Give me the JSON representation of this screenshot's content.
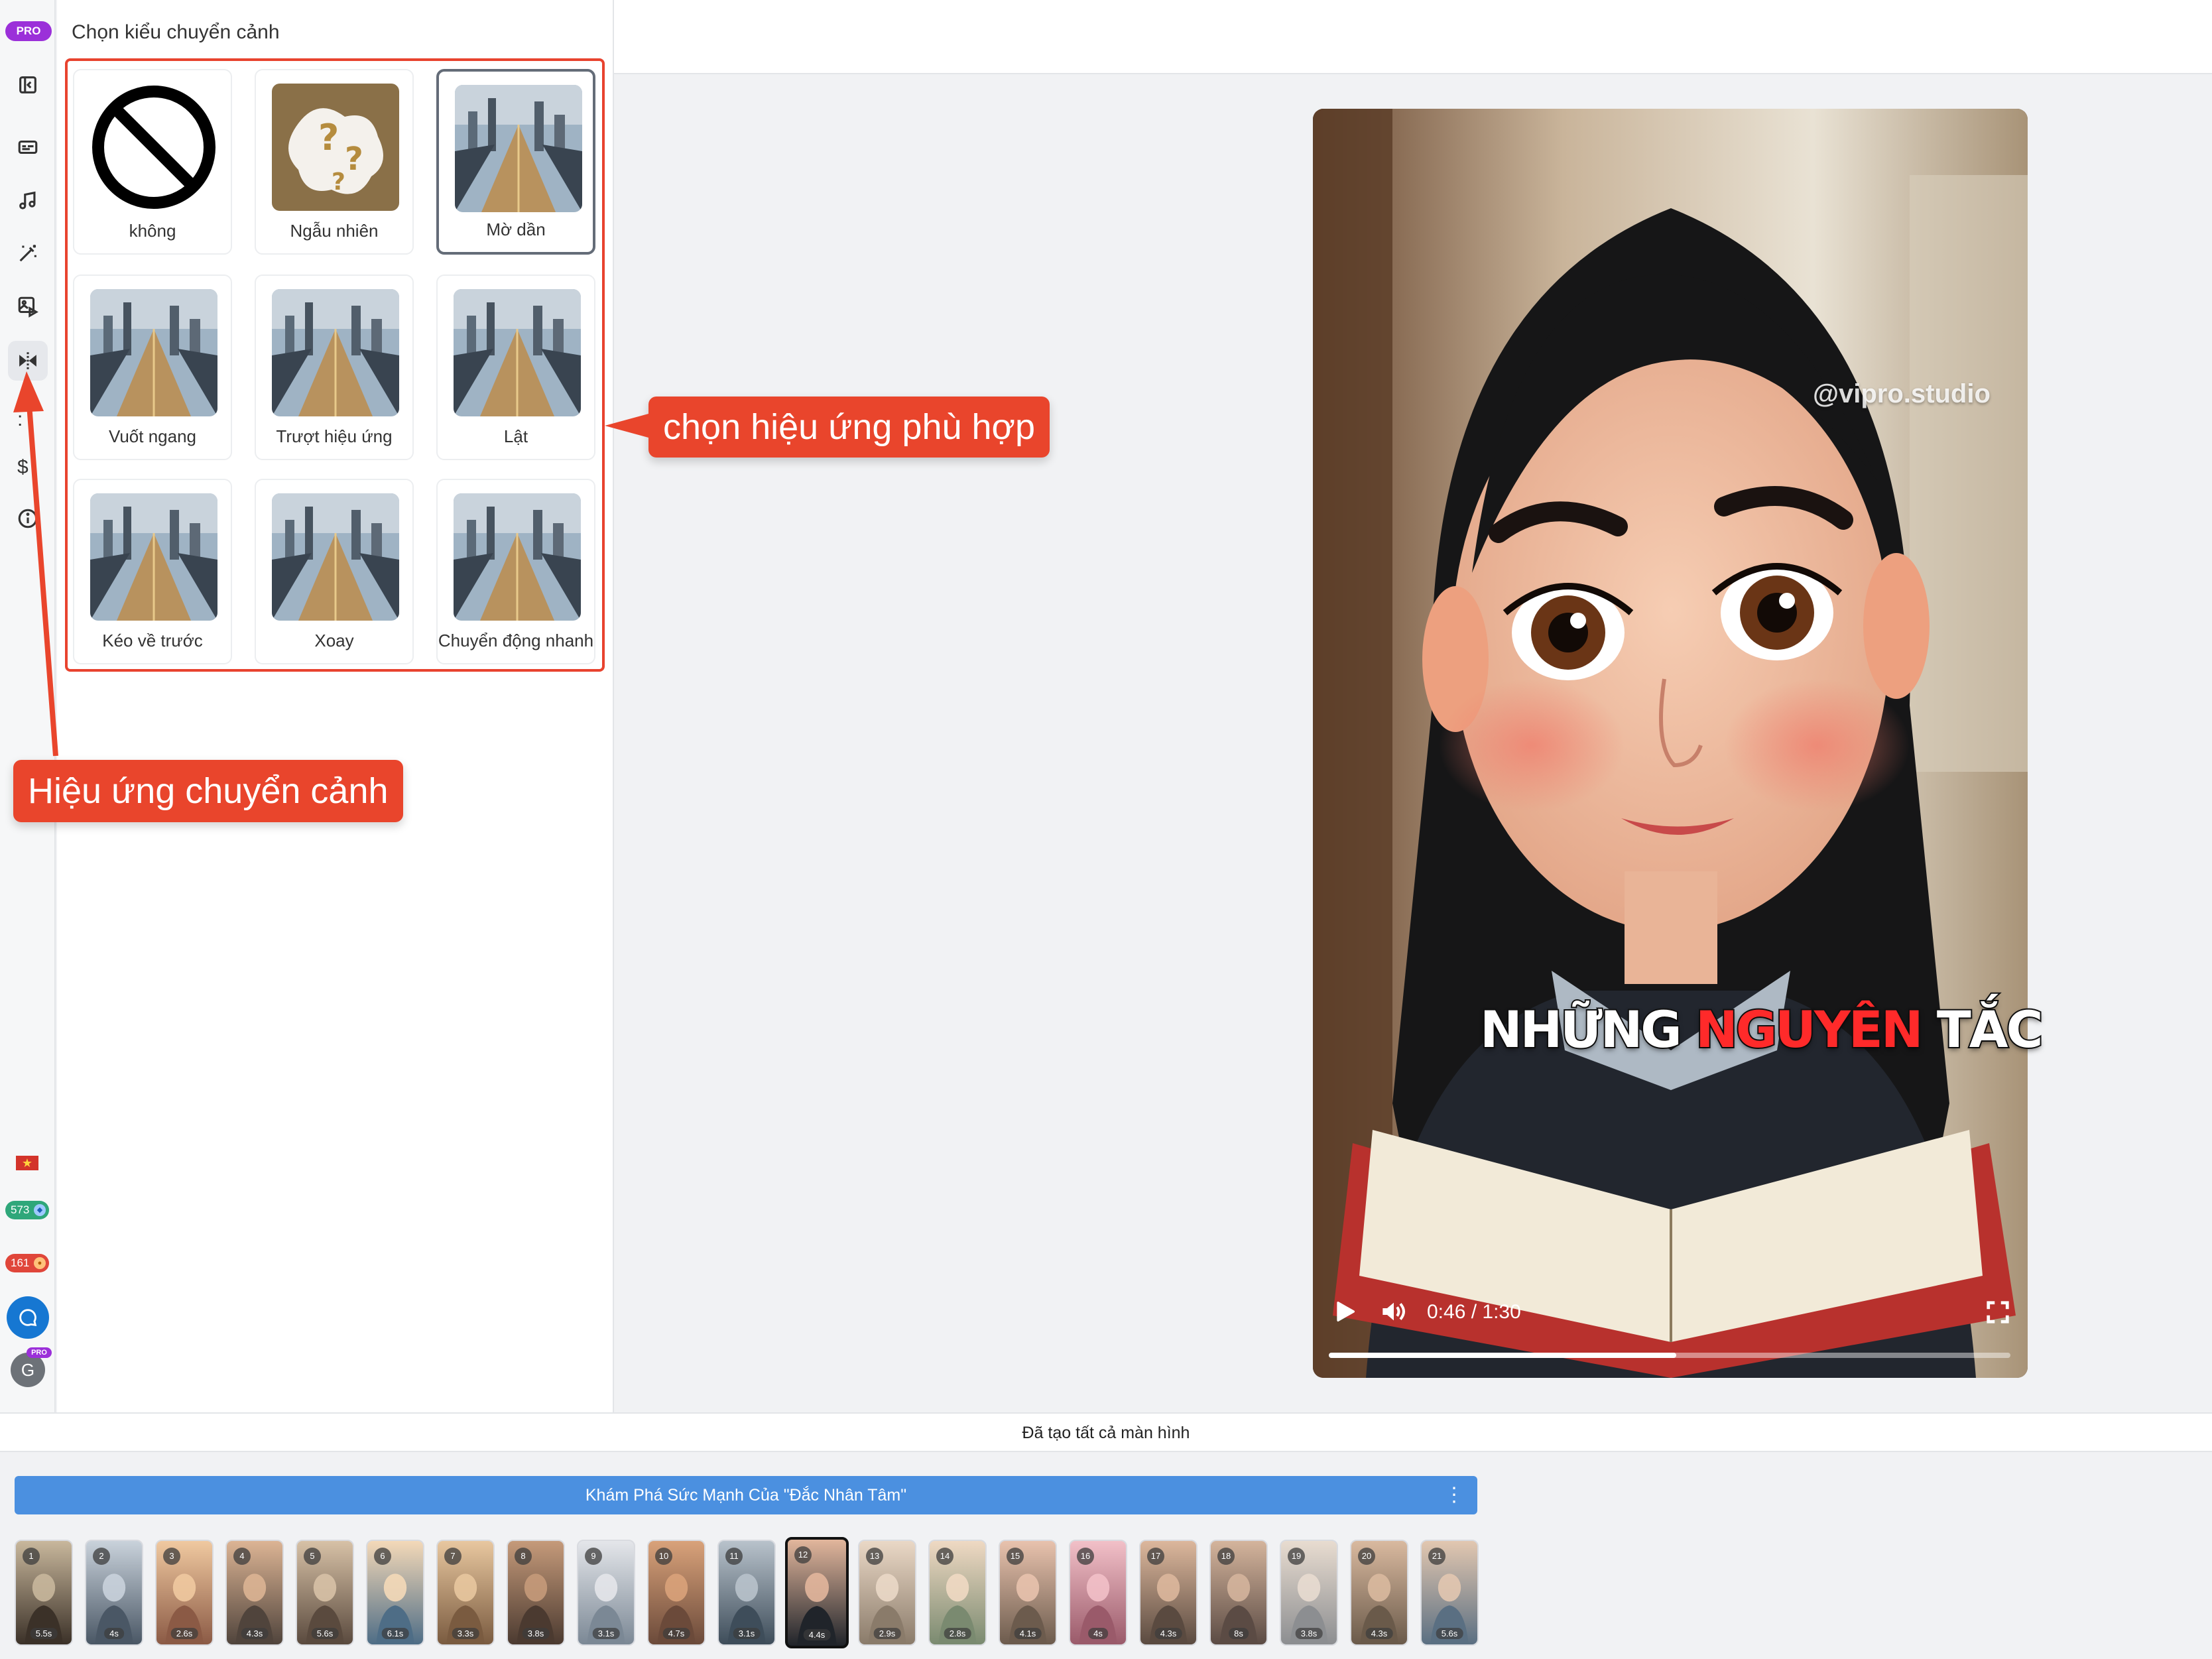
{
  "rail": {
    "pro_label": "PRO",
    "items": [
      {
        "name": "collapse-panel-icon"
      },
      {
        "name": "subtitle-icon"
      },
      {
        "name": "music-icon"
      },
      {
        "name": "magic-wand-icon"
      },
      {
        "name": "image-video-icon"
      },
      {
        "name": "transition-icon",
        "active": true
      }
    ],
    "flag": "★",
    "credit_green": "573",
    "credit_red": "161",
    "avatar_letter": "G",
    "avatar_badge": "PRO"
  },
  "panel": {
    "title": "Chọn kiểu chuyển cảnh",
    "options": [
      {
        "label": "không",
        "thumb": "none-icon",
        "selected": false
      },
      {
        "label": "Ngẫu nhiên",
        "thumb": "question-marks",
        "selected": false
      },
      {
        "label": "Mờ dần",
        "thumb": "city",
        "selected": true
      },
      {
        "label": "Vuốt ngang",
        "thumb": "city",
        "selected": false
      },
      {
        "label": "Trượt hiệu ứng",
        "thumb": "city",
        "selected": false
      },
      {
        "label": "Lật",
        "thumb": "city",
        "selected": false
      },
      {
        "label": "Kéo về trước",
        "thumb": "city",
        "selected": false
      },
      {
        "label": "Xoay",
        "thumb": "city",
        "selected": false
      },
      {
        "label": "Chuyển động nhanh",
        "thumb": "city",
        "selected": false
      }
    ]
  },
  "annotations": {
    "callout_effect": "chọn hiệu ứng phù hợp",
    "callout_transition": "Hiệu ứng chuyển cảnh",
    "color": "#e9452c"
  },
  "player": {
    "watermark": "@vipro.studio",
    "caption_before": "NHỮNG",
    "caption_highlight": "NGUYÊN",
    "caption_after": "TẮC",
    "time": "0:46 / 1:30",
    "progress": 0.51
  },
  "status": "Đã tạo tất cả màn hình",
  "script_title": "Khám Phá Sức Mạnh Của \"Đắc Nhân Tâm\"",
  "scenes": [
    {
      "num": "1",
      "dur": "5.5s"
    },
    {
      "num": "2",
      "dur": "4s"
    },
    {
      "num": "3",
      "dur": "2.6s"
    },
    {
      "num": "4",
      "dur": "4.3s"
    },
    {
      "num": "5",
      "dur": "5.6s"
    },
    {
      "num": "6",
      "dur": "6.1s"
    },
    {
      "num": "7",
      "dur": "3.3s"
    },
    {
      "num": "8",
      "dur": "3.8s"
    },
    {
      "num": "9",
      "dur": "3.1s"
    },
    {
      "num": "10",
      "dur": "4.7s"
    },
    {
      "num": "11",
      "dur": "3.1s"
    },
    {
      "num": "12",
      "dur": "4.4s",
      "selected": true
    },
    {
      "num": "13",
      "dur": "2.9s"
    },
    {
      "num": "14",
      "dur": "2.8s"
    },
    {
      "num": "15",
      "dur": "4.1s"
    },
    {
      "num": "16",
      "dur": "4s"
    },
    {
      "num": "17",
      "dur": "4.3s"
    },
    {
      "num": "18",
      "dur": "8s"
    },
    {
      "num": "19",
      "dur": "3.8s"
    },
    {
      "num": "20",
      "dur": "4.3s"
    },
    {
      "num": "21",
      "dur": "5.6s"
    }
  ]
}
